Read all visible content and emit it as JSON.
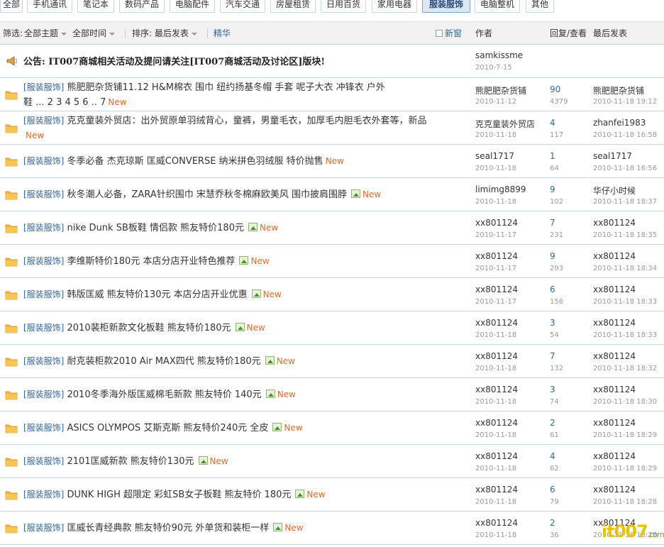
{
  "tabs": [
    {
      "label": "全部",
      "active": false
    },
    {
      "label": "手机通讯",
      "active": false
    },
    {
      "label": "笔记本",
      "active": false
    },
    {
      "label": "数码产品",
      "active": false
    },
    {
      "label": "电脑配件",
      "active": false
    },
    {
      "label": "汽车交通",
      "active": false
    },
    {
      "label": "房屋租赁",
      "active": false
    },
    {
      "label": "日用百货",
      "active": false
    },
    {
      "label": "家用电器",
      "active": false
    },
    {
      "label": "服装服饰",
      "active": true
    },
    {
      "label": "电脑整机",
      "active": false
    },
    {
      "label": "其他",
      "active": false
    }
  ],
  "filter": {
    "label": "筛选:",
    "topic": "全部主题",
    "time": "全部时间",
    "sort": "排序: 最后发表",
    "digest": "精华",
    "new_window": "新窗",
    "col_author": "作者",
    "col_replies": "回复/查看",
    "col_last": "最后发表"
  },
  "announcement": {
    "text": "公告: IT007商城相关活动及提问请关注[IT007商城活动及讨论区]版块!",
    "author": "samkissme",
    "date": "2010-7-15"
  },
  "threads": [
    {
      "cat": "[服装服饰]",
      "title": "熊肥肥杂货铺11.12 H&M棉衣 围巾 纽约扬基冬帽 手套 呢子大衣 冲锋衣 户外",
      "title2": "鞋",
      "pages": "... 2 3 4 5 6 .. 7",
      "new": "New",
      "author": "熊肥肥杂货铺",
      "date": "2010-11-12",
      "replies": "90",
      "views": "4379",
      "last_user": "熊肥肥杂货铺",
      "last_time": "2010-11-18 19:12"
    },
    {
      "cat": "[服装服饰]",
      "title": "克克童装外贸店：出外贸原单羽绒背心，童裤，男童毛衣，加厚毛内胆毛衣外套等，新品",
      "new": "New",
      "author": "克克童装外贸店",
      "date": "2010-11-18",
      "replies": "4",
      "views": "117",
      "last_user": "zhanfei1983",
      "last_time": "2010-11-18 16:58"
    },
    {
      "cat": "[服装服饰]",
      "title": "冬季必备 杰克琼斯 匡威CONVERSE 纳米拼色羽绒服 特价抛售",
      "new": "New",
      "author": "seal1717",
      "date": "2010-11-18",
      "replies": "1",
      "views": "64",
      "last_user": "seal1717",
      "last_time": "2010-11-18 16:56"
    },
    {
      "cat": "[服装服饰]",
      "title": "秋冬潮人必备，ZARA针织围巾 宋慧乔秋冬棉麻欧美风 围巾披肩围脖",
      "new": "New",
      "img": true,
      "author": "limimg8899",
      "date": "2010-11-18",
      "replies": "9",
      "views": "102",
      "last_user": "华仔小时候",
      "last_time": "2010-11-18 18:37"
    },
    {
      "cat": "[服装服饰]",
      "title": "nike Dunk SB板鞋 情侣款 熊友特价180元",
      "new": "New",
      "img": true,
      "author": "xx801124",
      "date": "2010-11-17",
      "replies": "7",
      "views": "231",
      "last_user": "xx801124",
      "last_time": "2010-11-18 18:35"
    },
    {
      "cat": "[服装服饰]",
      "title": "李维斯特价180元 本店分店开业特色推荐",
      "new": "New",
      "img": true,
      "author": "xx801124",
      "date": "2010-11-17",
      "replies": "9",
      "views": "293",
      "last_user": "xx801124",
      "last_time": "2010-11-18 18:34"
    },
    {
      "cat": "[服装服饰]",
      "title": "韩版匡威 熊友特价130元 本店分店开业优惠",
      "new": "New",
      "img": true,
      "author": "xx801124",
      "date": "2010-11-17",
      "replies": "6",
      "views": "156",
      "last_user": "xx801124",
      "last_time": "2010-11-18 18:33"
    },
    {
      "cat": "[服装服饰]",
      "title": "2010裴柜新款文化板鞋 熊友特价180元",
      "new": "New",
      "img": true,
      "author": "xx801124",
      "date": "2010-11-18",
      "replies": "3",
      "views": "54",
      "last_user": "xx801124",
      "last_time": "2010-11-18 18:33"
    },
    {
      "cat": "[服装服饰]",
      "title": "耐克装柜款2010 Air MAX四代 熊友特价180元",
      "new": "New",
      "img": true,
      "author": "xx801124",
      "date": "2010-11-18",
      "replies": "7",
      "views": "132",
      "last_user": "xx801124",
      "last_time": "2010-11-18 18:32"
    },
    {
      "cat": "[服装服饰]",
      "title": "2010冬季海外版匡威棉毛新款 熊友特价 140元",
      "new": "New",
      "img": true,
      "author": "xx801124",
      "date": "2010-11-18",
      "replies": "3",
      "views": "74",
      "last_user": "xx801124",
      "last_time": "2010-11-18 18:30"
    },
    {
      "cat": "[服装服饰]",
      "title": "ASICS OLYMPOS 艾斯克斯 熊友特价240元 全皮",
      "new": "New",
      "img": true,
      "author": "xx801124",
      "date": "2010-11-18",
      "replies": "2",
      "views": "61",
      "last_user": "xx801124",
      "last_time": "2010-11-18 18:29"
    },
    {
      "cat": "[服装服饰]",
      "title": "2101匡威新款 熊友特价130元",
      "new": "New",
      "img": true,
      "author": "xx801124",
      "date": "2010-11-18",
      "replies": "4",
      "views": "62",
      "last_user": "xx801124",
      "last_time": "2010-11-18 18:29"
    },
    {
      "cat": "[服装服饰]",
      "title": "DUNK HIGH 超限定 彩虹SB女子板鞋 熊友特价 180元",
      "new": "New",
      "img": true,
      "author": "xx801124",
      "date": "2010-11-18",
      "replies": "6",
      "views": "79",
      "last_user": "xx801124",
      "last_time": "2010-11-18 18:28"
    },
    {
      "cat": "[服装服饰]",
      "title": "匡威长青经典款 熊友特价90元 外单货和装柜一样",
      "new": "New",
      "img": true,
      "author": "xx801124",
      "date": "2010-11-18",
      "replies": "2",
      "views": "36",
      "last_user": "xx801124",
      "last_time": "2010-11-18 18:28"
    }
  ],
  "watermark": {
    "brand": "it007",
    "domain": ".com"
  },
  "colors": {
    "link": "#336699",
    "new": "#e06a2a",
    "folder": "#f5b63a",
    "border": "#c2d5e3",
    "filter_bg": "#f2f2f2"
  }
}
